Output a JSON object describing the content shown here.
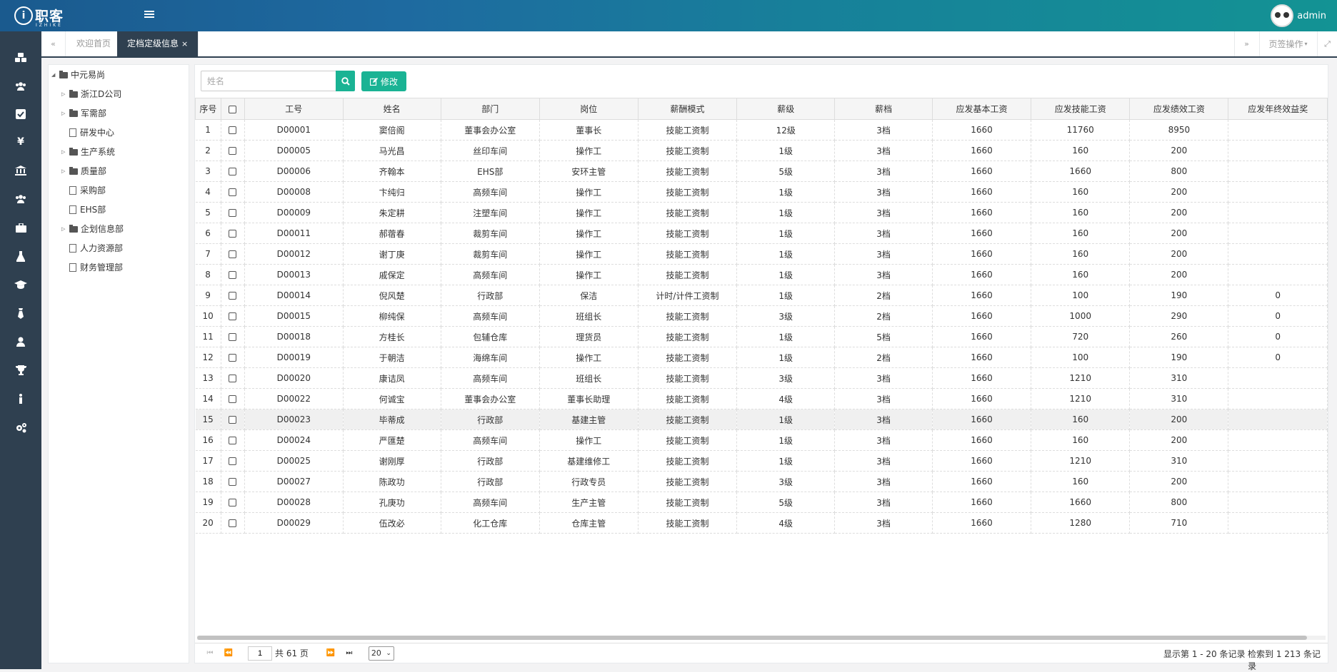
{
  "app": {
    "logo_text": "职客",
    "logo_sub": "IZHIKE",
    "logo_mark": "i",
    "username": "admin"
  },
  "sidebar_icons": [
    "cubes-icon",
    "users-icon",
    "check-square-icon",
    "yen-icon",
    "bank-icon",
    "team-icon",
    "briefcase-icon",
    "flask-icon",
    "graduation-cap-icon",
    "tie-icon",
    "user-icon",
    "trophy-icon",
    "info-icon",
    "cogs-icon"
  ],
  "tabs": {
    "back_icon": "«",
    "home": "欢迎首页",
    "active": "定档定级信息",
    "close_glyph": "×",
    "forward_icon": "»",
    "page_ops": "页签操作",
    "expand_icon": "⤢"
  },
  "tree": [
    {
      "label": "中元易尚",
      "type": "folder",
      "level": 0,
      "expanded": true
    },
    {
      "label": "浙江D公司",
      "type": "folder",
      "level": 1
    },
    {
      "label": "军需部",
      "type": "folder",
      "level": 1
    },
    {
      "label": "研发中心",
      "type": "file",
      "level": 1
    },
    {
      "label": "生产系统",
      "type": "folder",
      "level": 1
    },
    {
      "label": "质量部",
      "type": "folder",
      "level": 1
    },
    {
      "label": "采购部",
      "type": "file",
      "level": 1
    },
    {
      "label": "EHS部",
      "type": "file",
      "level": 1
    },
    {
      "label": "企划信息部",
      "type": "folder",
      "level": 1
    },
    {
      "label": "人力资源部",
      "type": "file",
      "level": 1
    },
    {
      "label": "财务管理部",
      "type": "file",
      "level": 1
    }
  ],
  "toolbar": {
    "search_placeholder": "姓名",
    "edit_label": "修改"
  },
  "table": {
    "columns": [
      "序号",
      "",
      "工号",
      "姓名",
      "部门",
      "岗位",
      "薪酬模式",
      "薪级",
      "薪档",
      "应发基本工资",
      "应发技能工资",
      "应发绩效工资",
      "应发年终效益奖"
    ],
    "rows": [
      [
        "1",
        "",
        "D00001",
        "窦倍阁",
        "董事会办公室",
        "董事长",
        "技能工资制",
        "12级",
        "3档",
        "1660",
        "11760",
        "8950",
        ""
      ],
      [
        "2",
        "",
        "D00005",
        "马光昌",
        "丝印车间",
        "操作工",
        "技能工资制",
        "1级",
        "3档",
        "1660",
        "160",
        "200",
        ""
      ],
      [
        "3",
        "",
        "D00006",
        "齐翰本",
        "EHS部",
        "安环主管",
        "技能工资制",
        "5级",
        "3档",
        "1660",
        "1660",
        "800",
        ""
      ],
      [
        "4",
        "",
        "D00008",
        "卞纯归",
        "高频车间",
        "操作工",
        "技能工资制",
        "1级",
        "3档",
        "1660",
        "160",
        "200",
        ""
      ],
      [
        "5",
        "",
        "D00009",
        "朱定耕",
        "注塑车间",
        "操作工",
        "技能工资制",
        "1级",
        "3档",
        "1660",
        "160",
        "200",
        ""
      ],
      [
        "6",
        "",
        "D00011",
        "郝蓿春",
        "裁剪车间",
        "操作工",
        "技能工资制",
        "1级",
        "3档",
        "1660",
        "160",
        "200",
        ""
      ],
      [
        "7",
        "",
        "D00012",
        "谢丁庚",
        "裁剪车间",
        "操作工",
        "技能工资制",
        "1级",
        "3档",
        "1660",
        "160",
        "200",
        ""
      ],
      [
        "8",
        "",
        "D00013",
        "戚保定",
        "高频车间",
        "操作工",
        "技能工资制",
        "1级",
        "3档",
        "1660",
        "160",
        "200",
        ""
      ],
      [
        "9",
        "",
        "D00014",
        "倪风楚",
        "行政部",
        "保洁",
        "计时/计件工资制",
        "1级",
        "2档",
        "1660",
        "100",
        "190",
        "0"
      ],
      [
        "10",
        "",
        "D00015",
        "柳纯保",
        "高频车间",
        "班组长",
        "技能工资制",
        "3级",
        "2档",
        "1660",
        "1000",
        "290",
        "0"
      ],
      [
        "11",
        "",
        "D00018",
        "方桂长",
        "包辅仓库",
        "理货员",
        "技能工资制",
        "1级",
        "5档",
        "1660",
        "720",
        "260",
        "0"
      ],
      [
        "12",
        "",
        "D00019",
        "于朝洁",
        "海绵车间",
        "操作工",
        "技能工资制",
        "1级",
        "2档",
        "1660",
        "100",
        "190",
        "0"
      ],
      [
        "13",
        "",
        "D00020",
        "康诘凤",
        "高频车间",
        "班组长",
        "技能工资制",
        "3级",
        "3档",
        "1660",
        "1210",
        "310",
        ""
      ],
      [
        "14",
        "",
        "D00022",
        "何诚宝",
        "董事会办公室",
        "董事长助理",
        "技能工资制",
        "4级",
        "3档",
        "1660",
        "1210",
        "310",
        ""
      ],
      [
        "15",
        "",
        "D00023",
        "毕蒂成",
        "行政部",
        "基建主管",
        "技能工资制",
        "1级",
        "3档",
        "1660",
        "160",
        "200",
        ""
      ],
      [
        "16",
        "",
        "D00024",
        "严匯楚",
        "高频车间",
        "操作工",
        "技能工资制",
        "1级",
        "3档",
        "1660",
        "160",
        "200",
        ""
      ],
      [
        "17",
        "",
        "D00025",
        "谢刚厚",
        "行政部",
        "基建维修工",
        "技能工资制",
        "1级",
        "3档",
        "1660",
        "1210",
        "310",
        ""
      ],
      [
        "18",
        "",
        "D00027",
        "陈政功",
        "行政部",
        "行政专员",
        "技能工资制",
        "3级",
        "3档",
        "1660",
        "160",
        "200",
        ""
      ],
      [
        "19",
        "",
        "D00028",
        "孔庚功",
        "高频车间",
        "生产主管",
        "技能工资制",
        "5级",
        "3档",
        "1660",
        "1660",
        "800",
        ""
      ],
      [
        "20",
        "",
        "D00029",
        "伍改必",
        "化工仓库",
        "仓库主管",
        "技能工资制",
        "4级",
        "3档",
        "1660",
        "1280",
        "710",
        ""
      ]
    ],
    "highlight_row": 15
  },
  "pager": {
    "page": "1",
    "total_pages": "共 61 页",
    "page_size": "20",
    "showing": "显示第 1 - 20 条记录",
    "total": "检索到 1 213 条记录"
  }
}
